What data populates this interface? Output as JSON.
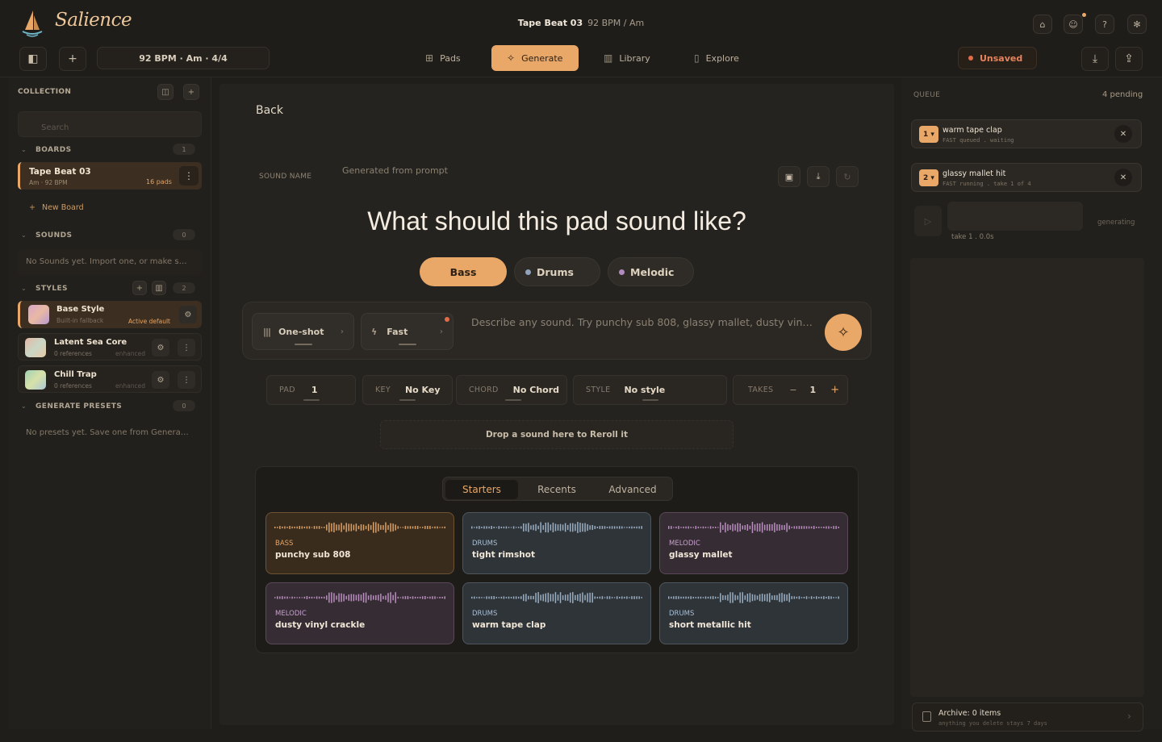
{
  "app": {
    "name": "Salience"
  },
  "header": {
    "doc_title": "Tape Beat 03",
    "doc_meta": "92 BPM  /  Am",
    "tempo": "92 BPM · Am · 4/4",
    "unsaved": "Unsaved"
  },
  "nav": {
    "pads": "Pads",
    "generate": "Generate",
    "library": "Library",
    "explore": "Explore"
  },
  "collection": {
    "title": "COLLECTION",
    "search_placeholder": "Search",
    "boards_label": "BOARDS",
    "boards_count": "1",
    "board": {
      "name": "Tape Beat 03",
      "meta": "Am · 92 BPM",
      "pads": "16 pads"
    },
    "new_board": "New Board",
    "sounds_label": "SOUNDS",
    "sounds_count": "0",
    "sounds_empty": "No Sounds yet. Import one, or make s…",
    "styles_label": "STYLES",
    "styles_count": "2",
    "styles": [
      {
        "name": "Base Style",
        "sub": "Built-in fallback",
        "right": "Active default"
      },
      {
        "name": "Latent Sea Core",
        "sub": "0 references",
        "right": "enhanced"
      },
      {
        "name": "Chill Trap",
        "sub": "0 references",
        "right": "enhanced"
      }
    ],
    "presets_label": "GENERATE PRESETS",
    "presets_count": "0",
    "presets_empty": "No presets yet. Save one from Genera…"
  },
  "main": {
    "back": "Back",
    "sound_name_label": "SOUND NAME",
    "sound_name_value": "Generated from prompt",
    "question": "What should this pad sound like?",
    "categories": [
      "Bass",
      "Drums",
      "Melodic"
    ],
    "mode": "One-shot",
    "speed": "Fast",
    "prompt_placeholder": "Describe any sound. Try punchy sub 808, glassy mallet, dusty vin…",
    "params": {
      "pad_label": "PAD",
      "pad_value": "1",
      "key_label": "KEY",
      "key_value": "No Key",
      "chord_label": "CHORD",
      "chord_value": "No Chord",
      "style_label": "STYLE",
      "style_value": "No style",
      "takes_label": "TAKES",
      "takes_value": "1",
      "minus": "−",
      "plus": "+"
    },
    "drop": "Drop a sound here to Reroll it",
    "tabs": [
      "Starters",
      "Recents",
      "Advanced"
    ],
    "starters": [
      {
        "kind": "BASS",
        "name": "punchy sub 808"
      },
      {
        "kind": "DRUMS",
        "name": "tight rimshot"
      },
      {
        "kind": "MELODIC",
        "name": "glassy mallet"
      },
      {
        "kind": "MELODIC",
        "name": "dusty vinyl crackle"
      },
      {
        "kind": "DRUMS",
        "name": "warm tape clap"
      },
      {
        "kind": "DRUMS",
        "name": "short metallic hit"
      }
    ]
  },
  "queue": {
    "title": "QUEUE",
    "pending": "4 pending",
    "items": [
      {
        "num": "1",
        "name": "warm tape clap",
        "status": "FAST  queued . waiting"
      },
      {
        "num": "2",
        "name": "glassy mallet hit",
        "status": "FAST  running . take 1 of 4"
      }
    ],
    "generating": "generating",
    "take": "take 1 . 0.0s",
    "archive_title": "Archive: 0 items",
    "archive_sub": "anything you delete stays 7 days"
  },
  "colors": {
    "accent": "#eaa868",
    "unsaved": "#e06c4a",
    "drums_dot": "#8fa3bd",
    "melodic_dot": "#b48bc0",
    "bg": "#201e1a"
  }
}
